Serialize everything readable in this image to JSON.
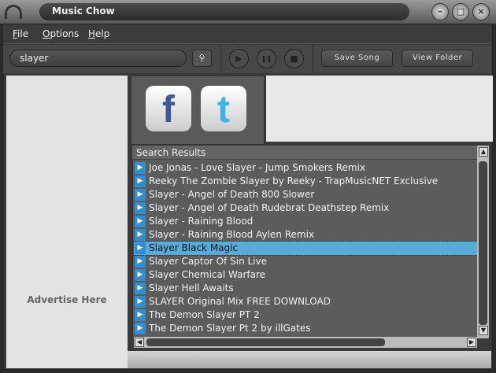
{
  "window": {
    "title": "Music Chow",
    "minimize": "–",
    "maximize": "□",
    "close": "×"
  },
  "menu": [
    {
      "key": "F",
      "rest": "ile"
    },
    {
      "key": "O",
      "rest": "ptions"
    },
    {
      "key": "H",
      "rest": "elp"
    }
  ],
  "toolbar": {
    "search_value": "slayer",
    "search_icon": "⚲",
    "play": "▶",
    "pause": "❚❚",
    "stop": "■",
    "save_song": "Save Song",
    "view_folder": "View Folder"
  },
  "ad": {
    "text": "Advertise Here"
  },
  "social": {
    "facebook": "f",
    "twitter": "t"
  },
  "results": {
    "header": "Search Results",
    "selected_index": 6,
    "items": [
      "Joe Jonas - Love Slayer - Jump Smokers Remix",
      "Reeky The Zombie Slayer by Reeky - TrapMusicNET Exclusive",
      "Slayer - Angel of Death 800 Slower",
      "Slayer - Angel of Death Rudebrat Deathstep Remix",
      "Slayer - Raining Blood",
      "Slayer - Raining Blood Aylen Remix",
      "Slayer Black Magic",
      "Slayer Captor Of Sin Live",
      "Slayer Chemical Warfare",
      "Slayer Hell Awaits",
      "SLAYER Original Mix FREE DOWNLOAD",
      "The Demon Slayer PT 2",
      "The Demon Slayer Pt 2 by illGates"
    ]
  }
}
